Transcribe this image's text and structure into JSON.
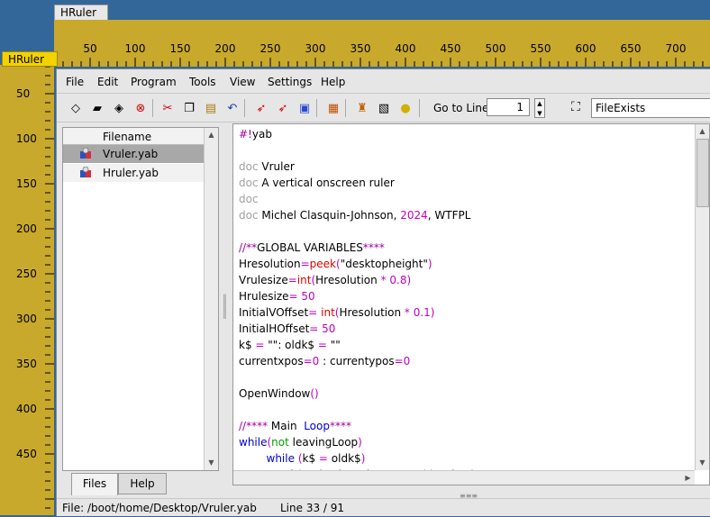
{
  "hruler_tab": "HRuler",
  "vruler_tab": "HRuler",
  "hruler_labels": [
    "50",
    "100",
    "150",
    "200",
    "250",
    "300",
    "350",
    "400",
    "450",
    "500",
    "550",
    "600",
    "650",
    "700"
  ],
  "vruler_labels": [
    "50",
    "100",
    "150",
    "200",
    "250",
    "300",
    "350",
    "400",
    "450"
  ],
  "menu": [
    "File",
    "Edit",
    "Program",
    "Tools",
    "View",
    "Settings",
    "Help"
  ],
  "toolbar": {
    "goto_label": "Go to Line:",
    "goto_value": "1",
    "find_value": "FileExists"
  },
  "files": {
    "header": "Filename",
    "items": [
      "Vruler.yab",
      "Hruler.yab"
    ]
  },
  "tabs": [
    "Files",
    "Help"
  ],
  "status": {
    "file": "File: /boot/home/Desktop/Vruler.yab",
    "line": "Line 33 / 91"
  },
  "colors": {
    "ruler": "#c8a92b",
    "desktop": "#336699",
    "selected_row": "#a8a8a8"
  }
}
